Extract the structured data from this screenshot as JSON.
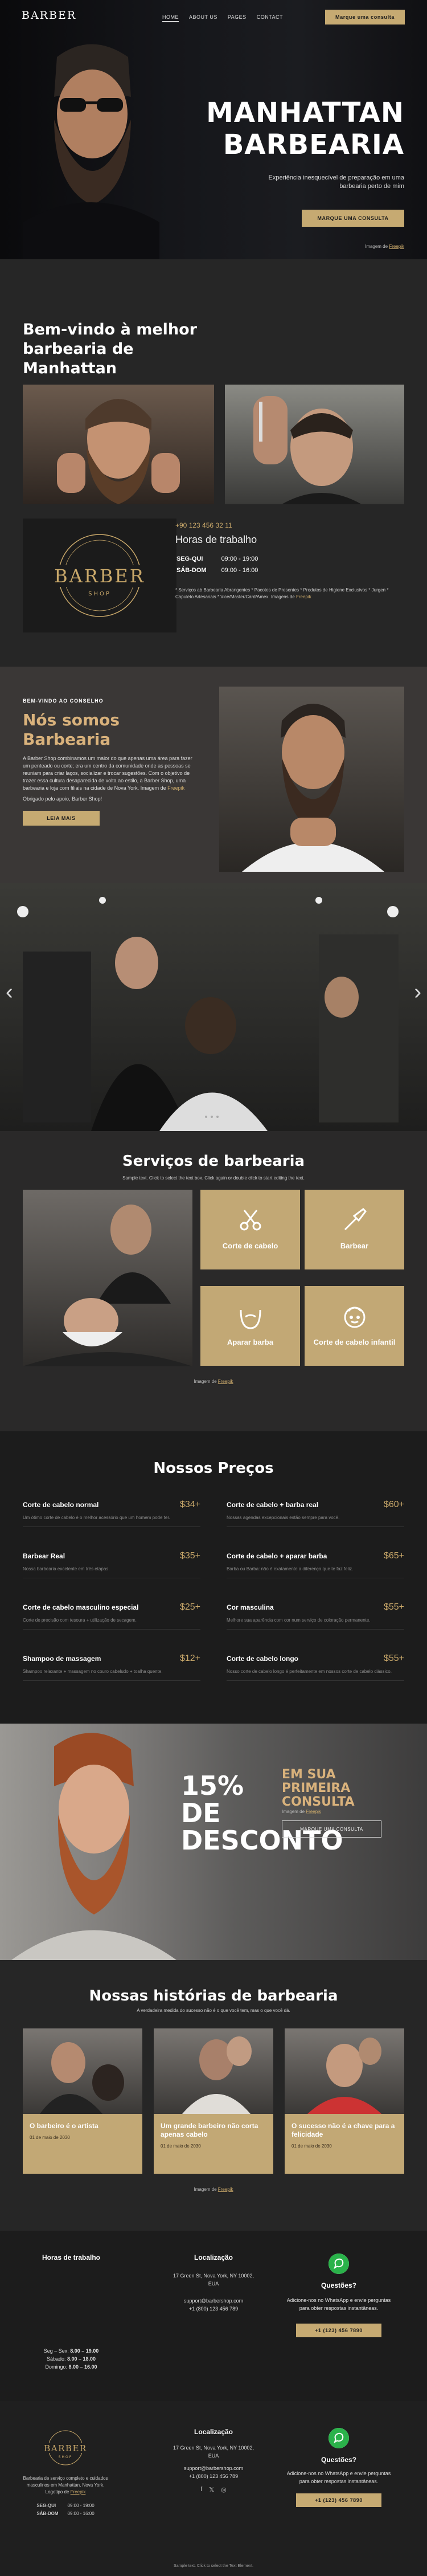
{
  "nav": {
    "logo": "BARBER",
    "items": [
      "HOME",
      "ABOUT US",
      "PAGES",
      "CONTACT"
    ],
    "cta": "Marque uma consulta"
  },
  "hero": {
    "title_line1": "MANHATTAN",
    "title_line2": "BARBEARIA",
    "subtitle": "Experiência inesquecível de preparação em uma barbearia perto de mim",
    "button": "MARQUE UMA CONSULTA",
    "credit_text": "Imagem de ",
    "credit_link": "Freepik"
  },
  "welcome": {
    "title": "Bem-vindo à melhor barbearia de Manhattan",
    "logo_text": "BARBER",
    "logo_sub": "SHOP",
    "logo_ring": "HAIRCUTS & SHAVING · WITH ST. MANHATTAN",
    "phone": "+90 123 456 32 11",
    "hours_title": "Horas de trabalho",
    "hours": [
      {
        "days": "SEG-QUI",
        "time": "09:00 - 19:00"
      },
      {
        "days": "SÁB-DOM",
        "time": "09:00 - 16:00"
      }
    ],
    "note": "* Serviços ab Barbearia Abrangentes * Pacotes de Presentes * Produtos de Higiene Exclusivos * Jurgen * Capuleto Artesanais *  Vice/Master/Card/Amex. ",
    "note_credit": "Imagens de ",
    "note_link": "Freepik"
  },
  "about": {
    "small": "BEM-VINDO AO CONSELHO",
    "title": "Nós somos Barbearia",
    "text": "A Barber Shop combinamos um maior do que apenas uma área para fazer um penteado ou corte; era um centro da comunidade onde as pessoas se reuniam para criar laços, socializar e trocar sugestões. Com o objetivo de trazer essa cultura desaparecida de volta ao estilo, a Barber Shop, uma barbearia e loja com filiais na cidade de Nova York. Imagem de ",
    "text_link": "Freepik",
    "text2": "Obrigado pelo apoio, Barber Shop!",
    "button": "LEIA MAIS"
  },
  "slider": {
    "prev": "‹",
    "next": "›"
  },
  "services": {
    "title": "Serviços de barbearia",
    "subtitle": "Sample text. Click to select the text box. Click again or double click to start editing the text.",
    "cards": [
      {
        "label": "Corte de cabelo",
        "icon": "scissors-comb-icon"
      },
      {
        "label": "Barbear",
        "icon": "razor-icon"
      },
      {
        "label": "Aparar barba",
        "icon": "beard-icon"
      },
      {
        "label": "Corte de cabelo infantil",
        "icon": "child-face-icon"
      }
    ],
    "credit_text": "Imagem de ",
    "credit_link": "Freepik"
  },
  "prices": {
    "title": "Nossos Preços",
    "items": [
      {
        "name": "Corte de cabelo normal",
        "price": "$34+",
        "desc": "Um ótimo corte de cabelo é o melhor acessório que um homem pode ter."
      },
      {
        "name": "Corte de cabelo + barba real",
        "price": "$60+",
        "desc": "Nossas agendas excepcionais estão sempre para você."
      },
      {
        "name": "Barbear Real",
        "price": "$35+",
        "desc": "Nossa barbearia excelente em trés etapas."
      },
      {
        "name": "Corte de cabelo + aparar barba",
        "price": "$65+",
        "desc": "Barba ou Barba: não é exatamente a diferença que te faz feliz."
      },
      {
        "name": "Corte de cabelo masculino especial",
        "price": "$25+",
        "desc": "Corte de precisão com tesoura + utilização de secagem."
      },
      {
        "name": "Cor masculina",
        "price": "$55+",
        "desc": "Melhore sua aparência com cor num serviço de coloração permanente."
      },
      {
        "name": "Shampoo de massagem",
        "price": "$12+",
        "desc": "Shampoo relaxante + massagem no couro cabeludo + toalha quente."
      },
      {
        "name": "Corte de cabelo longo",
        "price": "$55+",
        "desc": "Nosso corte de cabelo longo é perfeitamente em nossos corte de cabelo clássico."
      }
    ]
  },
  "promo": {
    "big": "15% DE DESCONTO",
    "head": "EM SUA PRIMEIRA CONSULTA",
    "credit_text": "Imagem de ",
    "credit_link": "Freepik",
    "button": "MARQUE UMA CONSULTA"
  },
  "stories": {
    "title": "Nossas histórias de barbearia",
    "subtitle": "A verdadeira medida do sucesso não é o que você tem, mas o que você dá.",
    "cards": [
      {
        "title": "O barbeiro é o artista",
        "date": "01 de maio de 2030"
      },
      {
        "title": "Um grande barbeiro não corta apenas cabelo",
        "date": "01 de maio de 2030"
      },
      {
        "title": "O sucesso não é a chave para a felicidade",
        "date": "01 de maio de 2030"
      }
    ],
    "credit_text": "Imagem de ",
    "credit_link": "Freepik"
  },
  "contact": {
    "hours_head": "Horas de trabalho",
    "hours": [
      {
        "days": "Seg – Sex:",
        "time": "8.00 – 19.00"
      },
      {
        "days": "Sábado:",
        "time": "8.00 – 18.00"
      },
      {
        "days": "Domingo:",
        "time": "8.00 – 16.00"
      }
    ],
    "loc_head": "Localização",
    "address": "17 Green St, Nova York, NY 10002, EUA",
    "email": "support@barbershop.com",
    "phone": "+1 (800) 123 456 789",
    "q_head": "Questões?",
    "q_text": "Adicione-nos no WhatsApp e envie perguntas para obter respostas instantâneas.",
    "q_button": "+1 (123) 456 7890"
  },
  "footer": {
    "logo_text": "BARBER",
    "logo_sub": "SHOP",
    "about": "Barbearia de serviço completo e cuidados masculinos em Manhattan, Nova York. Logotipo de ",
    "about_link": "Freepik",
    "hours": [
      {
        "days": "SEG-QUI",
        "time": "09:00 - 19:00"
      },
      {
        "days": "SÁB-DOM",
        "time": "09:00 - 16:00"
      }
    ],
    "loc_head": "Localização",
    "address": "17 Green St, Nova York, NY 10002, EUA",
    "email": "support@barbershop.com",
    "phone": "+1 (800) 123 456 789",
    "social": [
      "f",
      "𝕏",
      "◎"
    ],
    "q_head": "Questões?",
    "q_text": "Adicione-nos no WhatsApp e envie perguntas para obter respostas instantâneas.",
    "q_button": "+1 (123) 456 7890",
    "bottom": "Sample text. Click to select the Text Element."
  }
}
